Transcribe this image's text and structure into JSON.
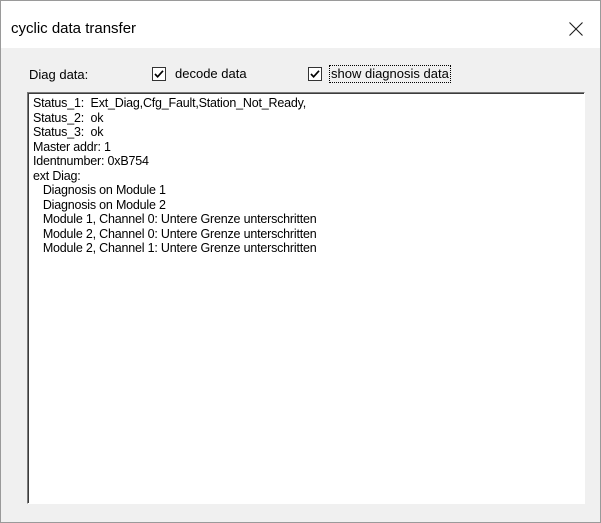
{
  "window": {
    "title": "cyclic data transfer"
  },
  "controls": {
    "diag_label": "Diag data:",
    "decode_checkbox": {
      "label": "decode data",
      "checked": true
    },
    "show_checkbox": {
      "label": "show diagnosis data",
      "checked": true
    }
  },
  "diagnosis": {
    "lines": [
      "Status_1:  Ext_Diag,Cfg_Fault,Station_Not_Ready,",
      "Status_2:  ok",
      "Status_3:  ok",
      "Master addr: 1",
      "Identnumber: 0xB754",
      "ext Diag:",
      "   Diagnosis on Module 1",
      "   Diagnosis on Module 2",
      "   Module 1, Channel 0: Untere Grenze unterschritten",
      "   Module 2, Channel 0: Untere Grenze unterschritten",
      "   Module 2, Channel 1: Untere Grenze unterschritten"
    ]
  },
  "icons": {
    "close": "close-icon",
    "check": "checkmark-icon"
  }
}
